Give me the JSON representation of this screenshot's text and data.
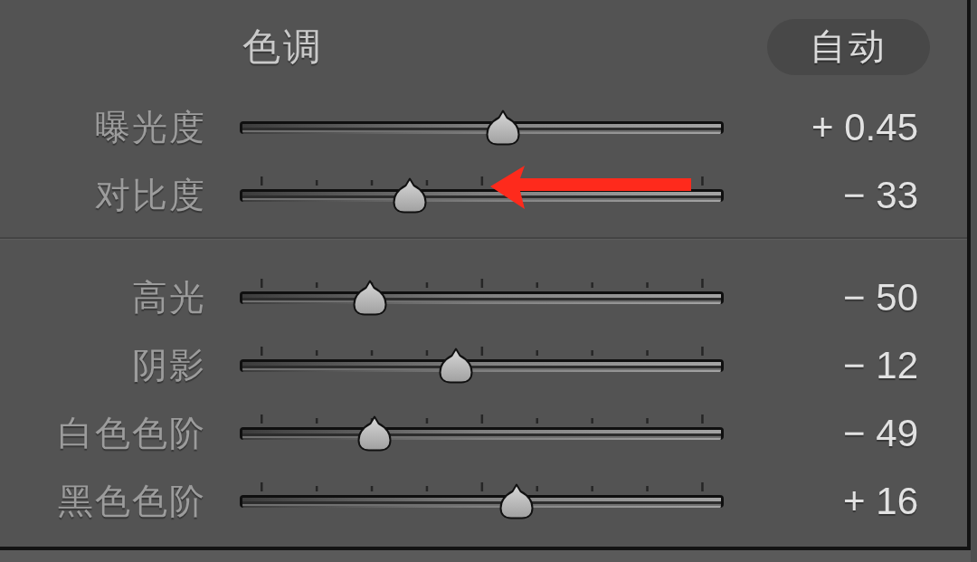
{
  "panel": {
    "title": "色调",
    "auto_button": "自动"
  },
  "groups": [
    {
      "sliders": [
        {
          "label": "曝光度",
          "level": 0.544,
          "value": "+ 0.45",
          "ticks": false,
          "arrow": false
        },
        {
          "label": "对比度",
          "level": 0.351,
          "value": "− 33",
          "ticks": true,
          "arrow": true
        }
      ]
    },
    {
      "sliders": [
        {
          "label": "高光",
          "level": 0.269,
          "value": "− 50",
          "ticks": true,
          "arrow": false
        },
        {
          "label": "阴影",
          "level": 0.447,
          "value": "− 12",
          "ticks": true,
          "arrow": false
        },
        {
          "label": "白色色阶",
          "level": 0.279,
          "value": "− 49",
          "ticks": true,
          "arrow": false
        },
        {
          "label": "黑色色阶",
          "level": 0.572,
          "value": "+ 16",
          "ticks": true,
          "arrow": false
        }
      ]
    }
  ]
}
